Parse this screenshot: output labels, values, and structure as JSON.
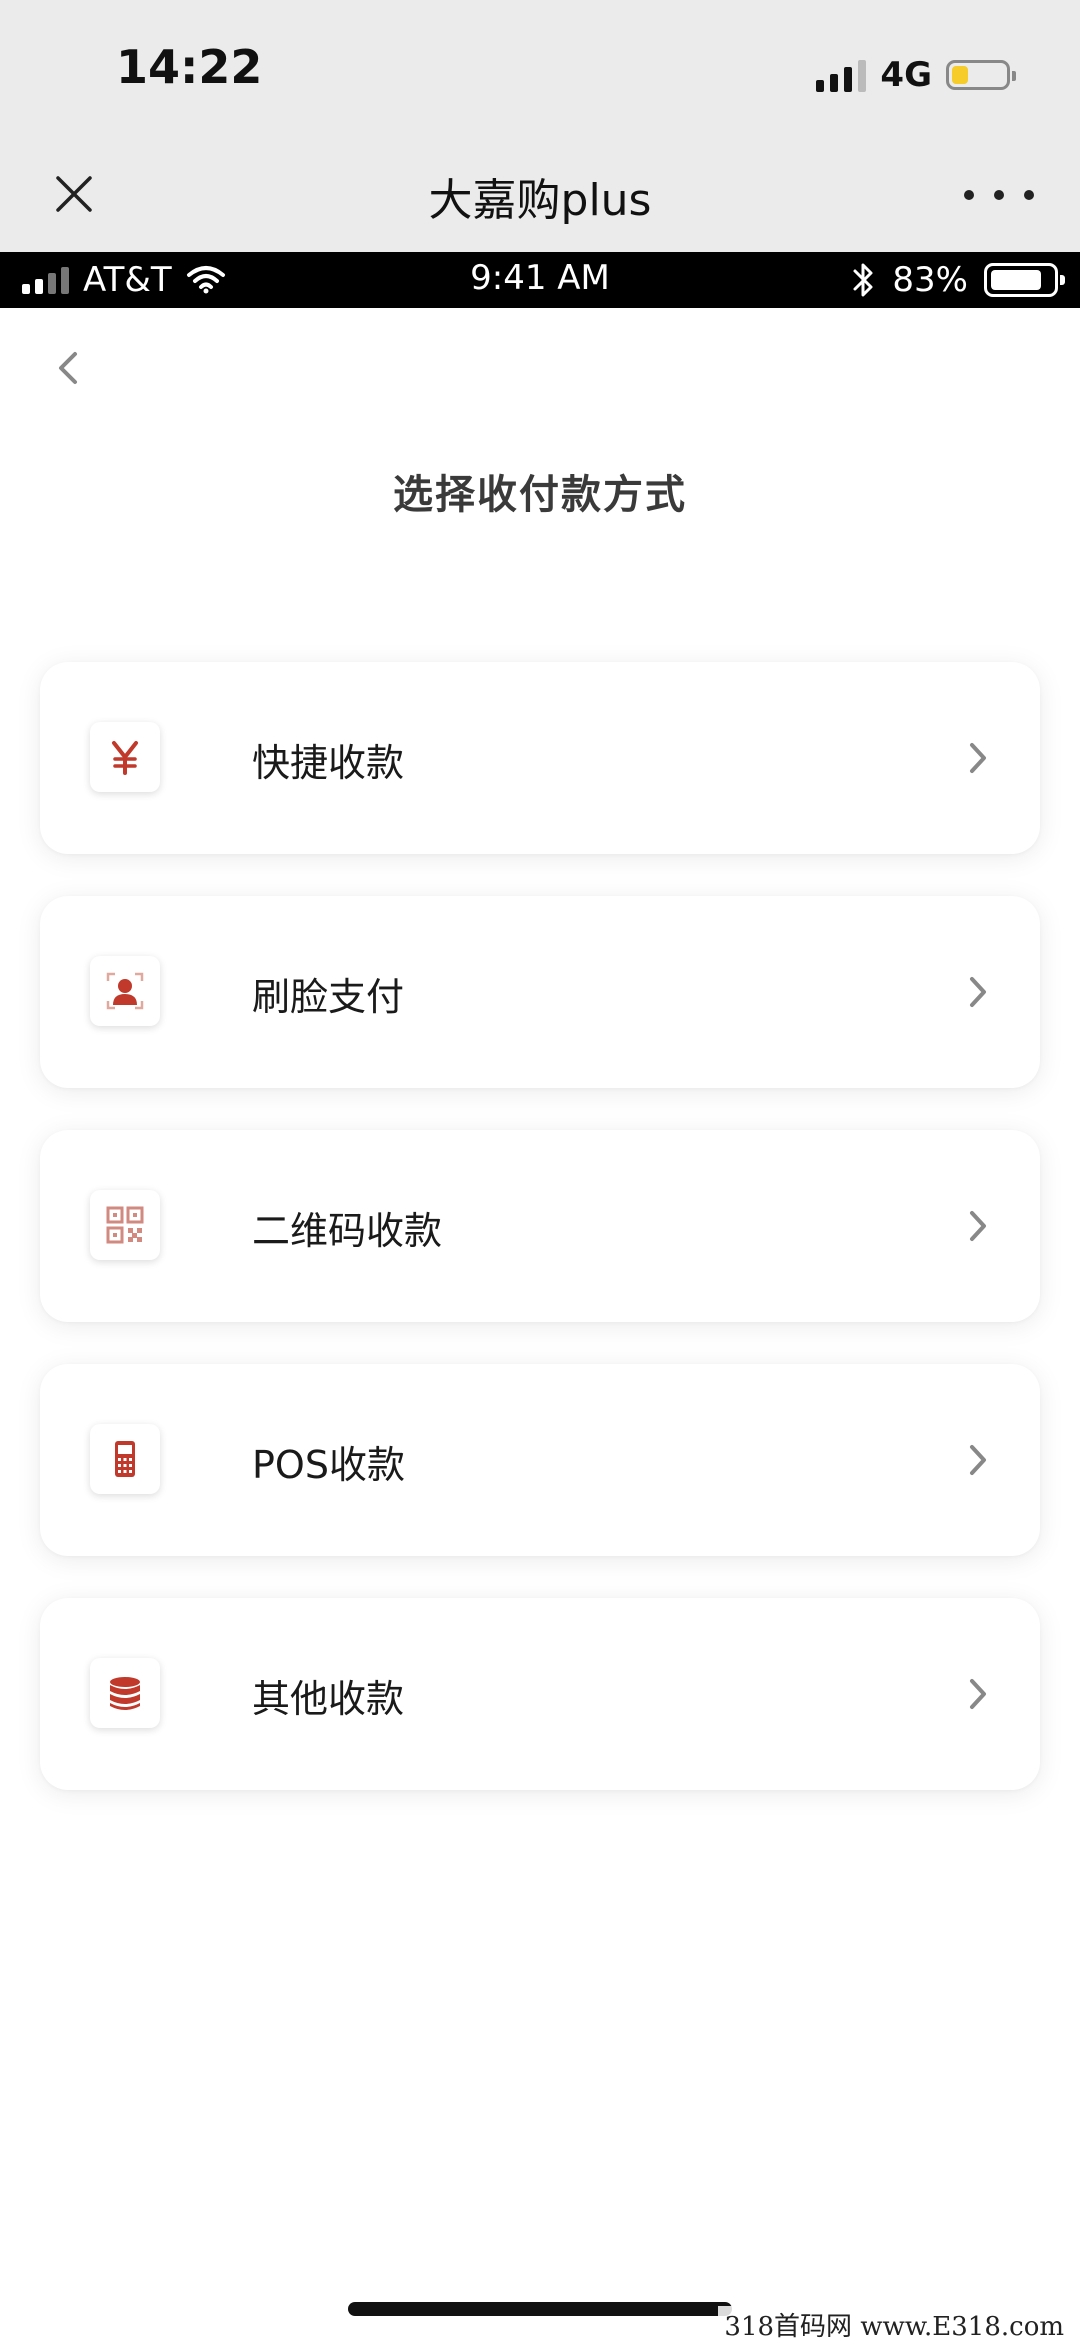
{
  "outer_status": {
    "time": "14:22",
    "network": "4G",
    "signal_icon": "cellular-signal-icon",
    "battery_icon": "battery-low-icon"
  },
  "navbar": {
    "title": "大嘉购plus",
    "close_icon": "close-icon",
    "more_icon": "more-dots-icon"
  },
  "inner_status": {
    "carrier": "AT&T",
    "time": "9:41 AM",
    "battery_percent": "83%",
    "battery_level": 0.83,
    "bluetooth_icon": "bluetooth-icon",
    "wifi_icon": "wifi-icon"
  },
  "page": {
    "title": "选择收付款方式",
    "back_icon": "back-chevron-icon"
  },
  "menu": {
    "items": [
      {
        "label": "快捷收款",
        "icon": "yen-icon"
      },
      {
        "label": "刷脸支付",
        "icon": "face-scan-icon"
      },
      {
        "label": "二维码收款",
        "icon": "qr-code-icon"
      },
      {
        "label": "POS收款",
        "icon": "pos-terminal-icon"
      },
      {
        "label": "其他收款",
        "icon": "coin-stack-icon"
      }
    ]
  },
  "colors": {
    "accent": "#c0392b",
    "nav_bg": "#ebebeb",
    "status_bar": "#000000"
  },
  "watermark": "318首码网 www.E318.com"
}
